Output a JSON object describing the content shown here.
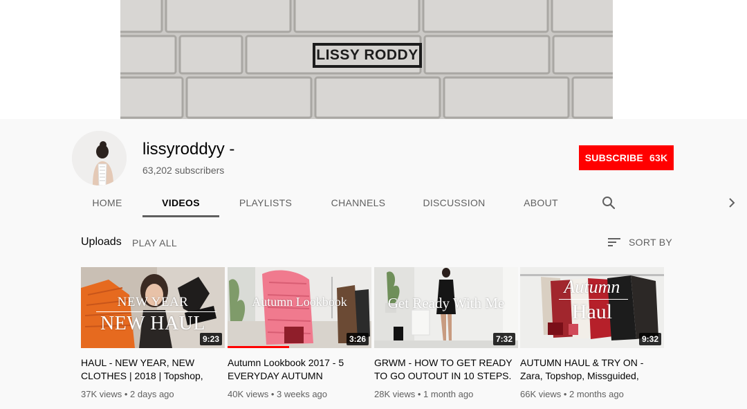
{
  "banner": {
    "logo_text": "LISSY RODDY"
  },
  "channel": {
    "name": "lissyroddyy -",
    "subscribers": "63,202 subscribers",
    "subscribe_label": "SUBSCRIBE",
    "subscribe_count": "63K"
  },
  "tabs": [
    {
      "label": "HOME"
    },
    {
      "label": "VIDEOS"
    },
    {
      "label": "PLAYLISTS"
    },
    {
      "label": "CHANNELS"
    },
    {
      "label": "DISCUSSION"
    },
    {
      "label": "ABOUT"
    }
  ],
  "active_tab": "VIDEOS",
  "icons": {
    "search": "search-icon",
    "next": "chevron-right-icon",
    "sort": "sort-icon"
  },
  "uploads": {
    "title": "Uploads",
    "play_all": "PLAY ALL",
    "sort_by": "SORT BY"
  },
  "videos": [
    {
      "thumb_line1": "NEW YEAR",
      "thumb_line2": "NEW HAUL",
      "duration": "9:23",
      "title": "HAUL - NEW YEAR, NEW CLOTHES | 2018 | Topshop,",
      "views": "37K views",
      "age": "2 days ago",
      "meta": "37K views • 2 days ago"
    },
    {
      "thumb_line1": "Autumn Lookbook",
      "duration": "3:26",
      "watched": 0.43,
      "title": "Autumn Lookbook 2017 - 5 EVERYDAY AUTUMN",
      "meta": "40K views • 3 weeks ago"
    },
    {
      "thumb_line1": "Get Ready With Me",
      "duration": "7:32",
      "title": "GRWM - HOW TO GET READY TO GO OUTOUT IN 10 STEPS.",
      "meta": "28K views • 1 month ago"
    },
    {
      "thumb_line1": "Autumn",
      "thumb_line2": "Haul",
      "duration": "9:32",
      "title": "AUTUMN HAUL & TRY ON - Zara, Topshop, Missguided,",
      "meta": "66K views • 2 months ago"
    }
  ],
  "colors": {
    "accent": "#ff0000",
    "text_secondary": "#606060",
    "background": "#f9f9f9"
  }
}
